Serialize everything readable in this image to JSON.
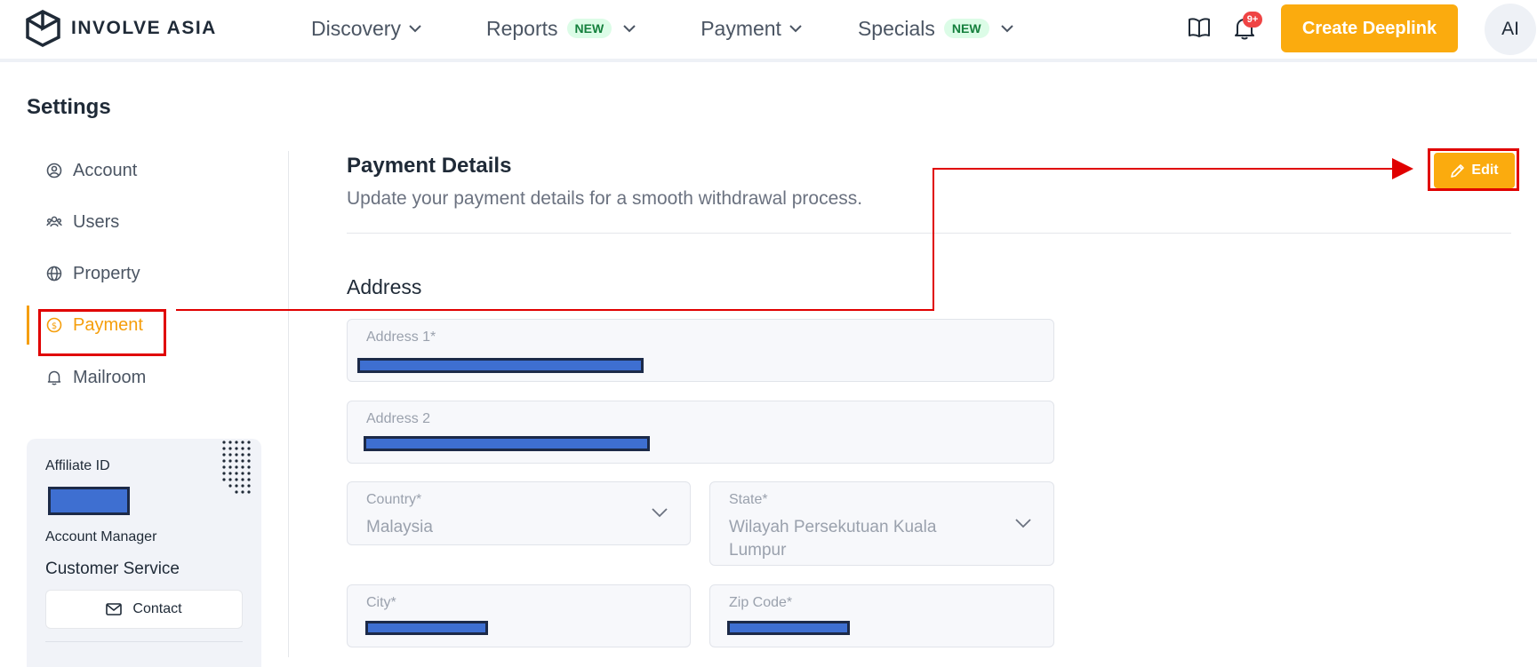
{
  "header": {
    "logo_text": "INVOLVE ASIA",
    "nav": [
      {
        "label": "Discovery",
        "badge": ""
      },
      {
        "label": "Reports",
        "badge": "NEW"
      },
      {
        "label": "Payment",
        "badge": ""
      },
      {
        "label": "Specials",
        "badge": "NEW"
      }
    ],
    "notification_count": "9+",
    "create_button": "Create Deeplink",
    "avatar_initials": "AI",
    "icons": [
      "book-icon",
      "bell-icon"
    ]
  },
  "page": {
    "title": "Settings"
  },
  "sidebar": {
    "items": [
      {
        "label": "Account",
        "icon": "user-circle-icon",
        "active": false
      },
      {
        "label": "Users",
        "icon": "users-icon",
        "active": false
      },
      {
        "label": "Property",
        "icon": "globe-icon",
        "active": false
      },
      {
        "label": "Payment",
        "icon": "dollar-circle-icon",
        "active": true
      },
      {
        "label": "Mailroom",
        "icon": "bell-icon",
        "active": false
      }
    ],
    "affiliate_id_label": "Affiliate ID",
    "account_manager_label": "Account Manager",
    "account_manager_value": "Customer Service",
    "contact_label": "Contact"
  },
  "main": {
    "title": "Payment Details",
    "subtitle": "Update your payment details for a smooth withdrawal process.",
    "edit_label": "Edit",
    "address_title": "Address",
    "fields": {
      "address1_label": "Address 1*",
      "address2_label": "Address 2",
      "country_label": "Country*",
      "country_value": "Malaysia",
      "state_label": "State*",
      "state_value": "Wilayah Persekutuan Kuala Lumpur",
      "city_label": "City*",
      "zip_label": "Zip Code*"
    }
  },
  "colors": {
    "accent": "#fbab0e",
    "active_text": "#f59e0b",
    "annotation_red": "#e00000",
    "redaction": "#3e6fd1",
    "badge_green": "#15803d"
  }
}
